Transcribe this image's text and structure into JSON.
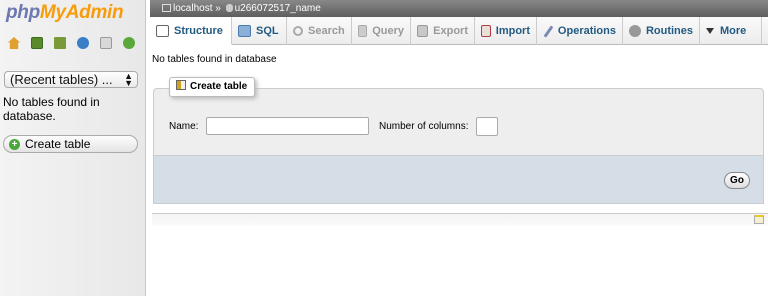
{
  "logo": {
    "php": "php",
    "my": "My",
    "admin": "Admin"
  },
  "nav": {
    "icons": [
      "home-icon",
      "sql-query-icon",
      "logout-icon",
      "help-icon",
      "docs-icon",
      "reload-icon"
    ],
    "recent_tables": "(Recent tables) ...",
    "empty_text": "No tables found in database.",
    "create_table": "Create table"
  },
  "breadcrumb": {
    "server": "localhost",
    "separator": "»",
    "database": "u266072517_name"
  },
  "tabs": [
    {
      "label": "Structure",
      "icon": "structure-icon",
      "state": "active"
    },
    {
      "label": "SQL",
      "icon": "sql-icon",
      "state": "normal"
    },
    {
      "label": "Search",
      "icon": "search-icon",
      "state": "disabled"
    },
    {
      "label": "Query",
      "icon": "query-icon",
      "state": "disabled"
    },
    {
      "label": "Export",
      "icon": "export-icon",
      "state": "disabled"
    },
    {
      "label": "Import",
      "icon": "import-icon",
      "state": "normal"
    },
    {
      "label": "Operations",
      "icon": "operations-icon",
      "state": "normal"
    },
    {
      "label": "Routines",
      "icon": "routines-icon",
      "state": "normal"
    },
    {
      "label": "More",
      "icon": "caret-down-icon",
      "state": "normal"
    }
  ],
  "main": {
    "message": "No tables found in database",
    "create_legend": "Create table",
    "name_label": "Name:",
    "name_value": "",
    "columns_label": "Number of columns:",
    "columns_value": "",
    "go_label": "Go"
  }
}
